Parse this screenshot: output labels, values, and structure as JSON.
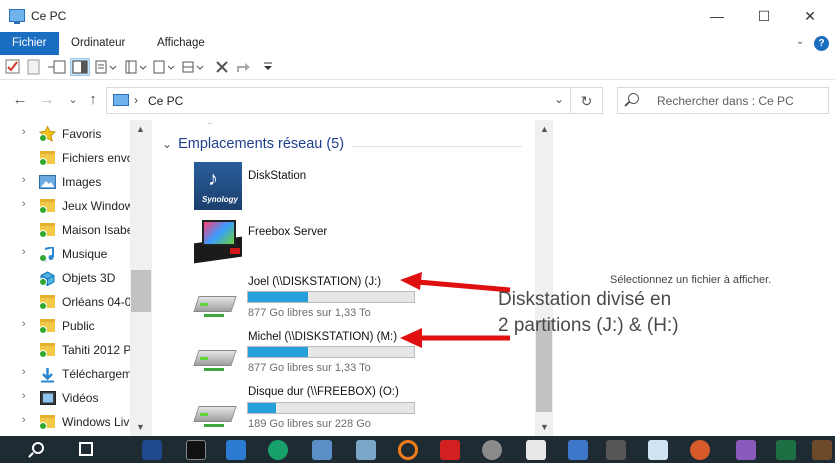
{
  "window": {
    "title": "Ce PC",
    "minimize": "—",
    "maximize": "☐",
    "close": "✕"
  },
  "ribbon": {
    "tabs": [
      "Fichier",
      "Ordinateur",
      "Affichage"
    ],
    "expand": "⌄",
    "help": "?"
  },
  "address": {
    "back": "←",
    "forward": "→",
    "recent": "⌄",
    "up": "↑",
    "separator": "›",
    "crumb": "Ce PC",
    "dropdown": "⌄",
    "refresh": "↻"
  },
  "search": {
    "placeholder": "Rechercher dans : Ce PC"
  },
  "nav_pane": {
    "items": [
      {
        "label": "Favoris",
        "icon": "star-icon"
      },
      {
        "label": "Fichiers envo",
        "icon": "folder-icon"
      },
      {
        "label": "Images",
        "icon": "pictures-icon"
      },
      {
        "label": "Jeux Window",
        "icon": "folder-icon"
      },
      {
        "label": "Maison Isabe",
        "icon": "folder-icon"
      },
      {
        "label": "Musique",
        "icon": "music-icon"
      },
      {
        "label": "Objets 3D",
        "icon": "cube-icon"
      },
      {
        "label": "Orléans 04-0",
        "icon": "folder-icon"
      },
      {
        "label": "Public",
        "icon": "folder-icon"
      },
      {
        "label": "Tahiti 2012 P",
        "icon": "folder-icon"
      },
      {
        "label": "Téléchargem",
        "icon": "download-icon"
      },
      {
        "label": "Vidéos",
        "icon": "video-icon"
      },
      {
        "label": "Windows Liv",
        "icon": "folder-icon"
      }
    ]
  },
  "content": {
    "group_header": "Emplacements réseau (5)",
    "items": [
      {
        "title": "DiskStation",
        "icon": "synology-icon"
      },
      {
        "title": "Freebox Server",
        "icon": "freebox-icon"
      },
      {
        "title": "Joel (\\\\DISKSTATION) (J:)",
        "free": "877 Go libres sur 1,33 To",
        "used_fraction": 0.36,
        "icon": "network-drive-icon"
      },
      {
        "title": "Michel (\\\\DISKSTATION) (M:)",
        "free": "877 Go libres sur 1,33 To",
        "used_fraction": 0.36,
        "icon": "network-drive-icon"
      },
      {
        "title": "Disque dur (\\\\FREEBOX) (O:)",
        "free": "189 Go libres sur 228 Go",
        "used_fraction": 0.17,
        "icon": "network-drive-icon"
      }
    ],
    "synology_brand": "Synology"
  },
  "preview": {
    "message": "Sélectionnez un fichier à afficher."
  },
  "annotation": {
    "line1": "Diskstation divisé en",
    "line2": "2 partitions (J:) & (H:)",
    "arrow_color": "#e01010"
  },
  "colors": {
    "accent": "#1a6ec1",
    "bar_fill": "#26a0da",
    "taskbar": "#1f2b33"
  }
}
